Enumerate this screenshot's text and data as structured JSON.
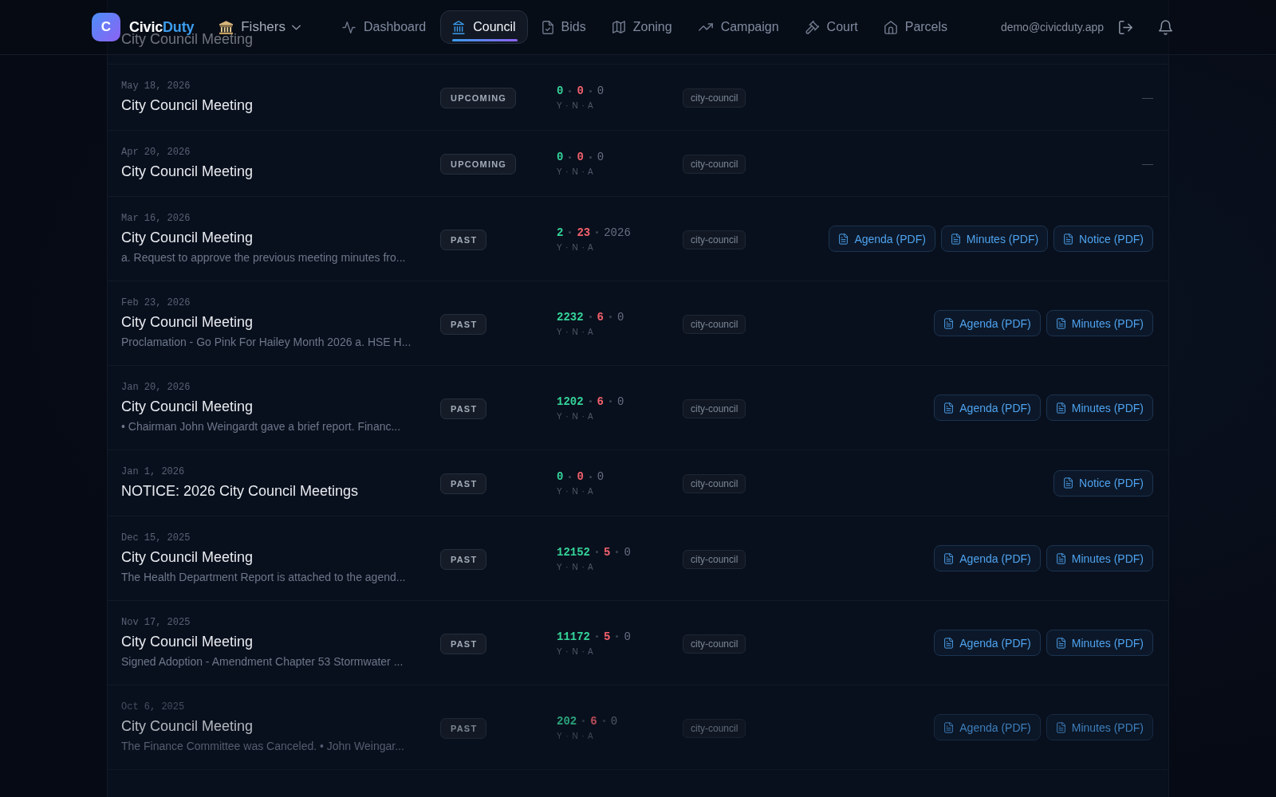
{
  "header": {
    "logo": {
      "letter": "C",
      "name_start": "Civic",
      "name_end": "Duty"
    },
    "city_picker": {
      "label": "Fishers"
    },
    "nav": [
      {
        "label": "Dashboard",
        "selected": false
      },
      {
        "label": "Council",
        "selected": true
      },
      {
        "label": "Bids",
        "selected": false
      },
      {
        "label": "Zoning",
        "selected": false
      },
      {
        "label": "Campaign",
        "selected": false
      },
      {
        "label": "Court",
        "selected": false
      },
      {
        "label": "Parcels",
        "selected": false
      }
    ],
    "user_email": "demo@civicduty.app"
  },
  "meetings": {
    "partial_row": {
      "title": "City Council Meeting"
    },
    "rows": [
      {
        "date": "May 18, 2026",
        "title": "City Council Meeting",
        "status": "UPCOMING",
        "votes": {
          "yes": "0",
          "no": "0",
          "abstain": "0"
        },
        "vote_legend": "Y · N · A",
        "tag": "city-council",
        "no_documents": "—"
      },
      {
        "date": "Apr 20, 2026",
        "title": "City Council Meeting",
        "status": "UPCOMING",
        "votes": {
          "yes": "0",
          "no": "0",
          "abstain": "0"
        },
        "vote_legend": "Y · N · A",
        "tag": "city-council",
        "no_documents": "—"
      },
      {
        "date": "Mar 16, 2026",
        "title": "City Council Meeting",
        "description": "a. Request to approve the previous meeting minutes fro...",
        "status": "PAST",
        "votes": {
          "yes": "2",
          "no": "23",
          "abstain": "2026"
        },
        "vote_legend": "Y · N · A",
        "tag": "city-council",
        "documents": [
          "Agenda (PDF)",
          "Minutes (PDF)",
          "Notice (PDF)"
        ]
      },
      {
        "date": "Feb 23, 2026",
        "title": "City Council Meeting",
        "description": "Proclamation - Go Pink For Hailey Month 2026 a. HSE H...",
        "status": "PAST",
        "votes": {
          "yes": "2232",
          "no": "6",
          "abstain": "0"
        },
        "vote_legend": "Y · N · A",
        "tag": "city-council",
        "documents": [
          "Agenda (PDF)",
          "Minutes (PDF)"
        ]
      },
      {
        "date": "Jan 20, 2026",
        "title": "City Council Meeting",
        "description": "• Chairman John Weingardt gave a brief report. Financ...",
        "status": "PAST",
        "votes": {
          "yes": "1202",
          "no": "6",
          "abstain": "0"
        },
        "vote_legend": "Y · N · A",
        "tag": "city-council",
        "documents": [
          "Agenda (PDF)",
          "Minutes (PDF)"
        ]
      },
      {
        "date": "Jan 1, 2026",
        "title": "NOTICE: 2026 City Council Meetings",
        "status": "PAST",
        "votes": {
          "yes": "0",
          "no": "0",
          "abstain": "0"
        },
        "vote_legend": "Y · N · A",
        "tag": "city-council",
        "documents": [
          "Notice (PDF)"
        ]
      },
      {
        "date": "Dec 15, 2025",
        "title": "City Council Meeting",
        "description": "The Health Department Report is attached to the agend...",
        "status": "PAST",
        "votes": {
          "yes": "12152",
          "no": "5",
          "abstain": "0"
        },
        "vote_legend": "Y · N · A",
        "tag": "city-council",
        "documents": [
          "Agenda (PDF)",
          "Minutes (PDF)"
        ]
      },
      {
        "date": "Nov 17, 2025",
        "title": "City Council Meeting",
        "description": "Signed Adoption - Amendment Chapter 53 Stormwater ...",
        "status": "PAST",
        "votes": {
          "yes": "11172",
          "no": "5",
          "abstain": "0"
        },
        "vote_legend": "Y · N · A",
        "tag": "city-council",
        "documents": [
          "Agenda (PDF)",
          "Minutes (PDF)"
        ]
      },
      {
        "date": "Oct 6, 2025",
        "title": "City Council Meeting",
        "description": "The Finance Committee was Canceled. • John Weingar...",
        "status": "PAST",
        "votes": {
          "yes": "202",
          "no": "6",
          "abstain": "0"
        },
        "vote_legend": "Y · N · A",
        "tag": "city-council",
        "documents": [
          "Agenda (PDF)",
          "Minutes (PDF)"
        ]
      }
    ]
  }
}
